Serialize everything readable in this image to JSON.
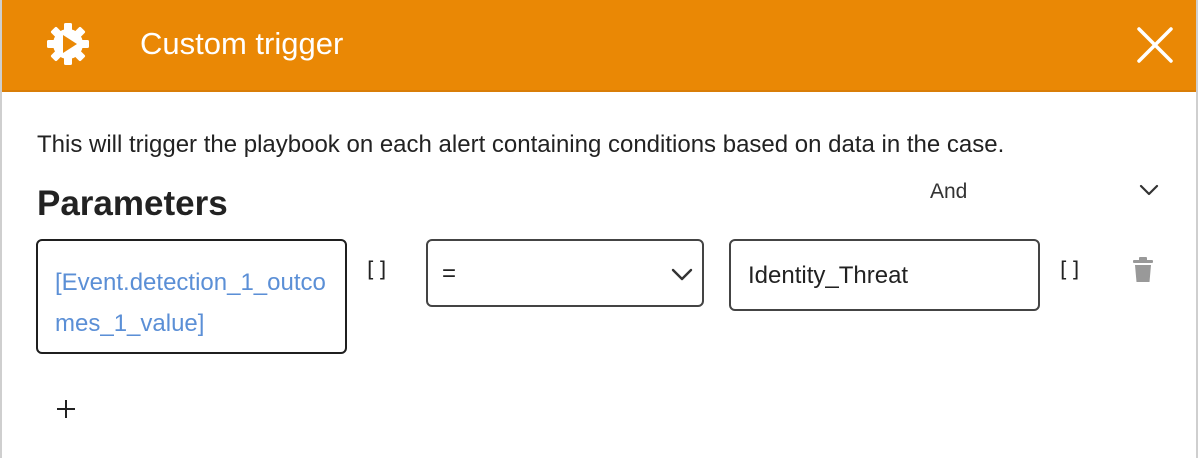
{
  "dialog": {
    "title": "Custom trigger",
    "header_color": "#ea8805",
    "header_icon": "gear-play-icon",
    "close_icon": "close-icon"
  },
  "description": "This will trigger the playbook on each alert containing conditions based on data in the case.",
  "parameters": {
    "title": "Parameters",
    "logic_operator": "And",
    "condition": {
      "field": "[Event.detection_1_outcomes_1_value]",
      "field_bracket_label": "[]",
      "operator": "=",
      "value": "Identity_Threat",
      "value_bracket_label": "[]",
      "delete_icon": "trash-icon"
    },
    "add_icon": "plus-icon"
  },
  "colors": {
    "accent": "#ea8805",
    "placeholder_link": "#5b8fd6"
  }
}
